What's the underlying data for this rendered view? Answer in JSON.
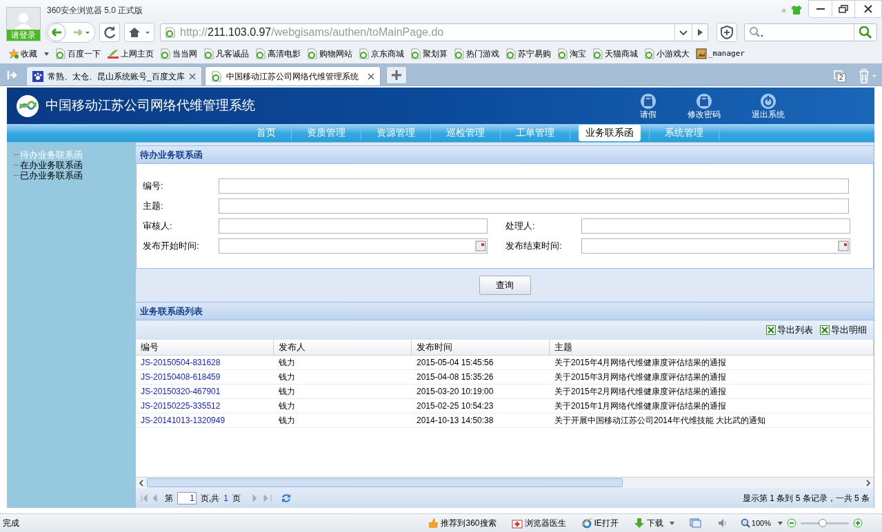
{
  "browser": {
    "title": "360安全浏览器 5.0 正式版",
    "login": "请登录",
    "collapse": "«",
    "address": {
      "scheme": "http://",
      "host": "211.103.0.97",
      "path": "/webgisams/authen/toMainPage.do"
    },
    "bookmarks": [
      {
        "label": "收藏",
        "kind": "menu"
      },
      {
        "label": "百度一下",
        "kind": "page"
      },
      {
        "label": "上网主页",
        "kind": "hao"
      },
      {
        "label": "当当网",
        "kind": "page"
      },
      {
        "label": "凡客诚品",
        "kind": "page"
      },
      {
        "label": "高清电影",
        "kind": "page"
      },
      {
        "label": "购物网站",
        "kind": "page"
      },
      {
        "label": "京东商城",
        "kind": "page"
      },
      {
        "label": "聚划算",
        "kind": "page"
      },
      {
        "label": "热门游戏",
        "kind": "page"
      },
      {
        "label": "苏宁易购",
        "kind": "page"
      },
      {
        "label": "淘宝",
        "kind": "page"
      },
      {
        "label": "天猫商城",
        "kind": "page"
      },
      {
        "label": "小游戏大",
        "kind": "page"
      },
      {
        "label": "_manager",
        "kind": "image"
      }
    ],
    "tabs": [
      {
        "label": "常熟、太仓、昆山系统账号_百度文库",
        "kind": "paw",
        "selected": false
      },
      {
        "label": "中国移动江苏公司网络代维管理系统",
        "kind": "page",
        "selected": true
      }
    ],
    "tab_count": "2"
  },
  "app": {
    "title": "中国移动江苏公司网络代维管理系统",
    "header_actions": [
      {
        "label": "请假",
        "kind": "lock"
      },
      {
        "label": "修改密码",
        "kind": "lock"
      },
      {
        "label": "退出系统",
        "kind": "power"
      }
    ],
    "nav": [
      {
        "label": "首页",
        "selected": false
      },
      {
        "label": "资质管理",
        "selected": false
      },
      {
        "label": "资源管理",
        "selected": false
      },
      {
        "label": "巡检管理",
        "selected": false
      },
      {
        "label": "工单管理",
        "selected": false
      },
      {
        "label": "业务联系函",
        "selected": true
      },
      {
        "label": "系统管理",
        "selected": false
      }
    ],
    "sidebar": [
      {
        "label": "待办业务联系函",
        "selected": true
      },
      {
        "label": "在办业务联系函",
        "selected": false
      },
      {
        "label": "已办业务联系函",
        "selected": false
      }
    ],
    "search_panel": {
      "title": "待办业务联系函",
      "rows": [
        [
          {
            "label": "编号:",
            "kind": "text"
          }
        ],
        [
          {
            "label": "主题:",
            "kind": "text"
          }
        ],
        [
          {
            "label": "审核人:",
            "kind": "text"
          },
          {
            "label": "处理人:",
            "kind": "text"
          }
        ],
        [
          {
            "label": "发布开始时间:",
            "kind": "date"
          },
          {
            "label": "发布结束时间:",
            "kind": "date"
          }
        ]
      ],
      "button": "查询"
    },
    "list": {
      "title": "业务联系函列表",
      "tools": [
        "导出列表",
        "导出明细"
      ],
      "columns": [
        "编号",
        "发布人",
        "发布时间",
        "主题"
      ],
      "rows": [
        [
          "JS-20150504-831628",
          "钱力",
          "2015-05-04 15:45:56",
          "关于2015年4月网络代维健康度评估结果的通报"
        ],
        [
          "JS-20150408-618459",
          "钱力",
          "2015-04-08 15:35:26",
          "关于2015年3月网络代维健康度评估结果的通报"
        ],
        [
          "JS-20150320-467901",
          "钱力",
          "2015-03-20 10:19:00",
          "关于2015年2月网络代维健康度评估结果的通报"
        ],
        [
          "JS-20150225-335512",
          "钱力",
          "2015-02-25 10:54:23",
          "关于2015年1月网络代维健康度评估结果的通报"
        ],
        [
          "JS-20141013-1320949",
          "钱力",
          "2014-10-13 14:50:38",
          "关于开展中国移动江苏公司2014年代维技能 大比武的通知"
        ]
      ],
      "pager": {
        "before": "第",
        "page": "1",
        "middle": "页,共",
        "total": "1",
        "after": "页",
        "info": "显示第 1 条到 5 条记录，一共 5 条"
      }
    }
  },
  "status_bar": {
    "text": "完成",
    "items": [
      {
        "label": "推荐到360搜索",
        "kind": "thumb"
      },
      {
        "label": "浏览器医生",
        "kind": "kit"
      },
      {
        "label": "IE打开",
        "kind": "ie"
      },
      {
        "label": "下载",
        "kind": "download"
      }
    ],
    "zoom": "100%",
    "zoom_slider": {
      "level": 0.45
    }
  }
}
